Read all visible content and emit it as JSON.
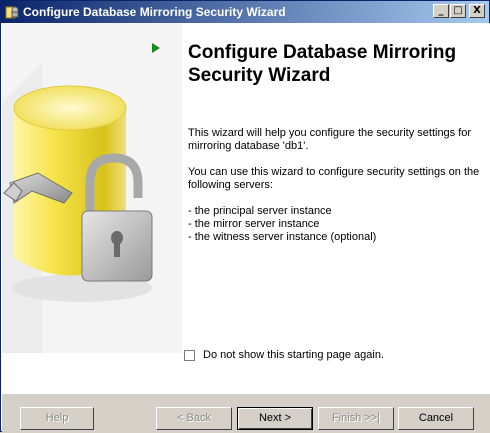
{
  "window": {
    "title": "Configure Database Mirroring Security Wizard"
  },
  "titlebar_buttons": {
    "minimize": "_",
    "maximize": "□",
    "close": "X"
  },
  "page": {
    "heading_line1": "Configure Database Mirroring",
    "heading_line2": "Security Wizard",
    "intro_line1": "This wizard will help you configure the security settings for",
    "intro_line2": "mirroring database 'db1'.",
    "servers_intro_line1": "You can use this wizard to configure security settings on the",
    "servers_intro_line2": "following servers:",
    "server_list": [
      "- the principal server instance",
      "- the mirror server instance",
      "- the witness server instance (optional)"
    ],
    "checkbox_label": "Do not show this starting page again.",
    "checkbox_checked": false
  },
  "buttons": {
    "help": "Help",
    "back": "< Back",
    "next": "Next >",
    "finish": "Finish >>|",
    "cancel": "Cancel"
  },
  "colors": {
    "titlebar_start": "#0a246a",
    "titlebar_end": "#a6caf0",
    "arrow": "#1b8a1b",
    "dialog_face": "#d4d0c8"
  }
}
